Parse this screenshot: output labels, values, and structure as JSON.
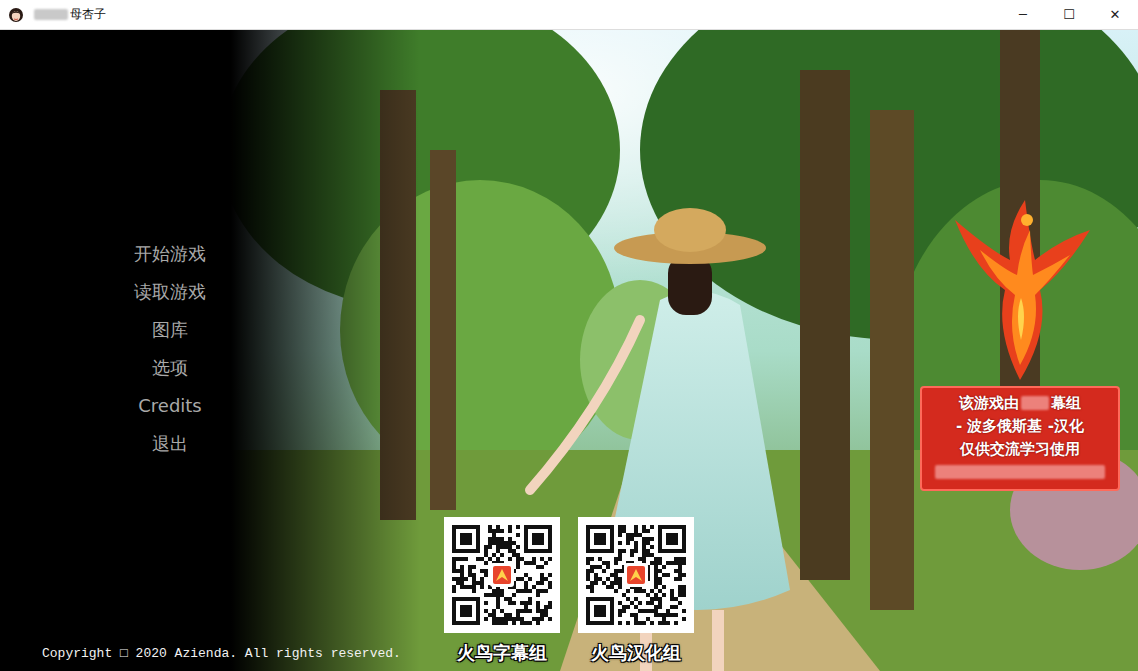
{
  "window": {
    "title": "母杏子",
    "controls": [
      "─",
      "☐",
      "✕"
    ]
  },
  "menu": [
    {
      "label": "开始游戏"
    },
    {
      "label": "读取游戏"
    },
    {
      "label": "图库"
    },
    {
      "label": "选项"
    },
    {
      "label": "Credits"
    },
    {
      "label": "退出"
    }
  ],
  "copyright": "Copyright □ 2020 Azienda. All rights reserved.",
  "qr_codes": [
    {
      "label": "火鸟字幕组"
    },
    {
      "label": "火鸟汉化组"
    }
  ],
  "badge": {
    "lines": [
      {
        "parts": [
          "该游戏由",
          "幕组"
        ]
      },
      {
        "parts": [
          "- 波多俄斯基 -汉化"
        ]
      },
      {
        "parts": [
          "仅供交流学习使用"
        ]
      },
      {
        "parts": []
      }
    ]
  }
}
